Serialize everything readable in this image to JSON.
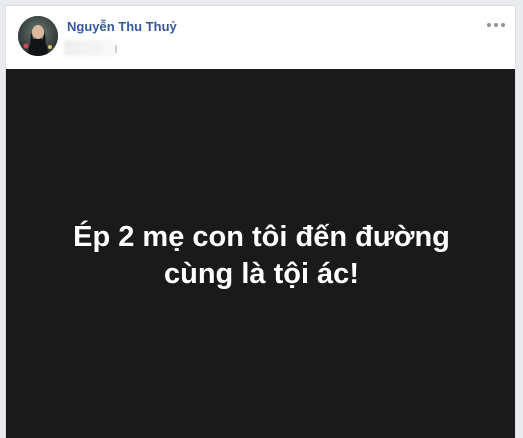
{
  "post": {
    "author": "Nguyễn Thu Thuỷ",
    "text_lines": [
      "Ép 2 mẹ con tôi đến đường",
      "cùng là tội ác!"
    ],
    "more_icon": "more-dots-icon",
    "media_background": "#1a1a1b"
  },
  "colors": {
    "author_link": "#365899",
    "page_background": "#e9ebee"
  }
}
